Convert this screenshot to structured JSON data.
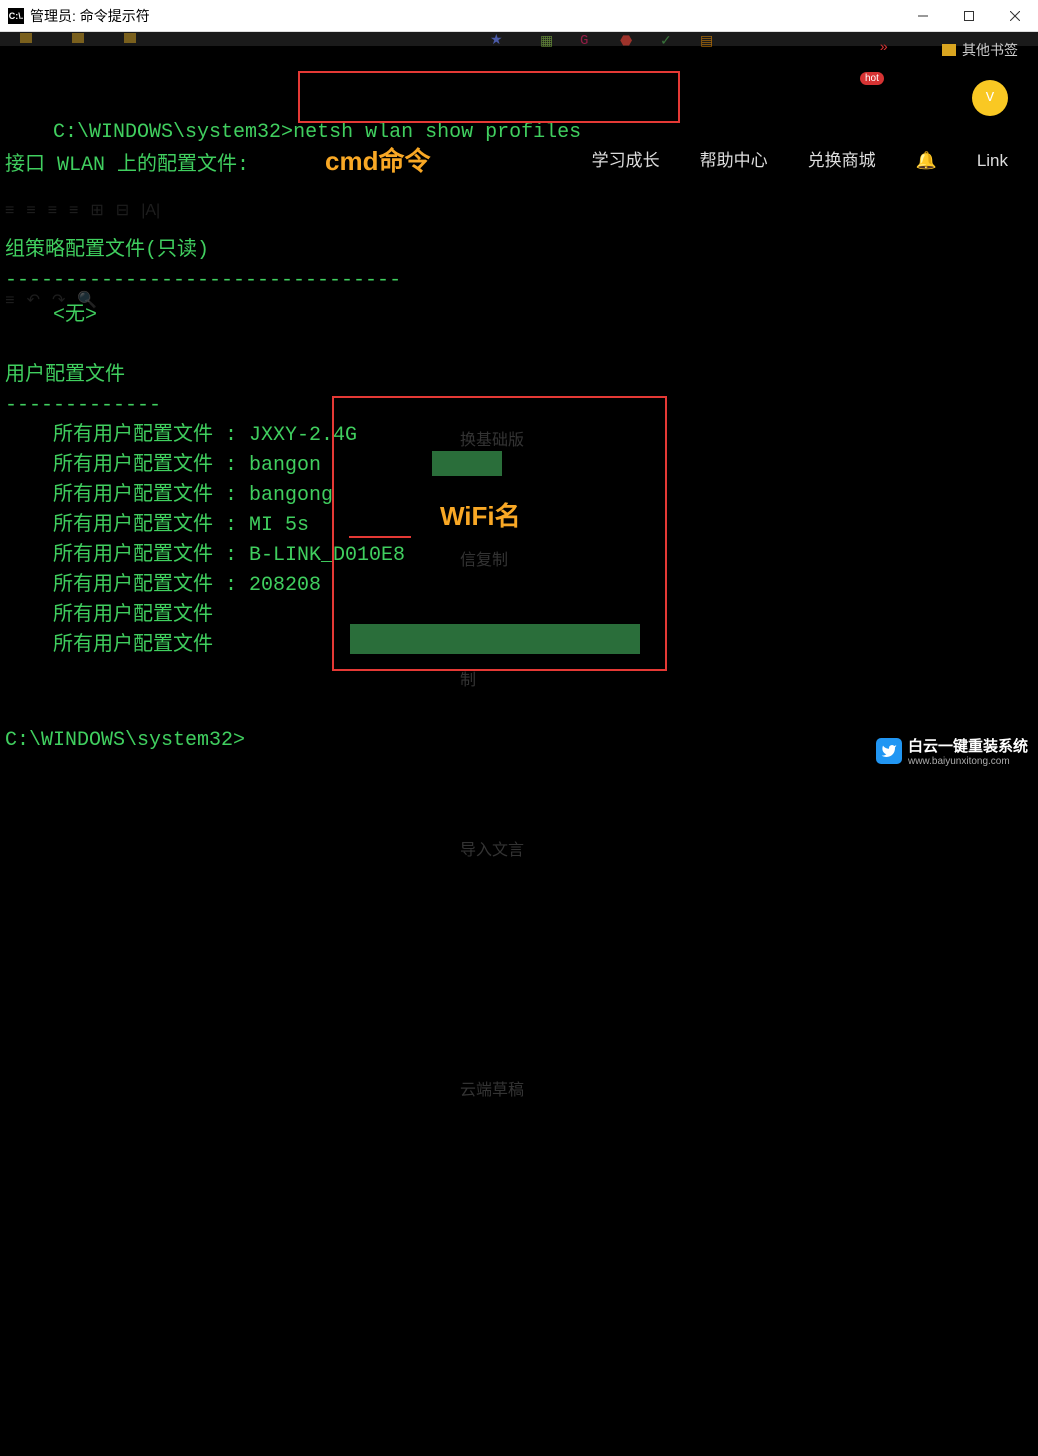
{
  "titlebar": {
    "icon_text": "C:\\.",
    "title": "管理员: 命令提示符"
  },
  "annotations": {
    "cmd_label": "cmd命令",
    "wifi_label": "WiFi名"
  },
  "terminal": {
    "prompt1": "C:\\WINDOWS\\system32>",
    "command": "netsh wlan show profiles",
    "header_line": "接口 WLAN 上的配置文件:",
    "group_policy_header": "组策略配置文件(只读)",
    "group_policy_divider": "---------------------------------",
    "none_value": "    <无>",
    "user_profile_header": "用户配置文件",
    "user_profile_divider": "-------------",
    "profiles": [
      {
        "label": "    所有用户配置文件 : ",
        "name": "JXXY-2.4G"
      },
      {
        "label": "    所有用户配置文件 : ",
        "name": "bangon"
      },
      {
        "label": "    所有用户配置文件 : ",
        "name": "bangong"
      },
      {
        "label": "    所有用户配置文件 : ",
        "name": "MI 5s"
      },
      {
        "label": "    所有用户配置文件 : ",
        "name": "B-LINK_D010E8"
      },
      {
        "label": "    所有用户配置文件 : ",
        "name": "208208"
      },
      {
        "label": "    所有用户配置文件",
        "name": ""
      },
      {
        "label": "    所有用户配置文件",
        "name": ""
      }
    ],
    "prompt2": "C:\\WINDOWS\\system32>"
  },
  "bg_nav": {
    "items": [
      "学习成长",
      "帮助中心",
      "兑换商城"
    ],
    "bell": "🔔",
    "link": "Link",
    "hot": "hot",
    "other_bookmarks": "其他书签",
    "arrows": "»"
  },
  "bg_panel": {
    "items": [
      "换基础版",
      "信复制",
      "制",
      "导入文言",
      "云端草稿"
    ]
  },
  "watermark": {
    "title": "白云一键重装系统",
    "url": "www.baiyunxitong.com"
  }
}
